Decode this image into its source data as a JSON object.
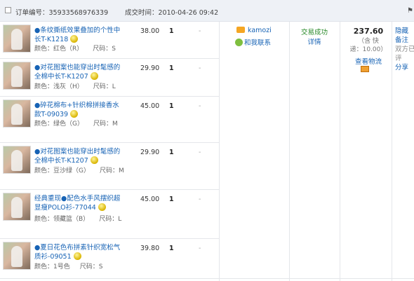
{
  "header": {
    "order_label": "订单编号：35933568976339",
    "time_label": "成交时间：2010-04-26 09:42",
    "flag_icon": "flag-icon"
  },
  "items": [
    {
      "title": "●条纹撕纸效果叠加的个性中长T-K1218",
      "attrs": "颜色：红色（R）",
      "size": "尺码：S",
      "price": "38.00",
      "qty": "1",
      "dash": "-"
    },
    {
      "title": "●对花图案也能穿出时髦感的全棉中长T-K1207",
      "attrs": "颜色：浅灰（H）",
      "size": "尺码：L",
      "price": "29.90",
      "qty": "1",
      "dash": "-"
    },
    {
      "title": "●碎花棉布+针织棉拼接香水款T-09039",
      "attrs": "颜色：绿色（G）",
      "size": "尺码：M",
      "price": "45.00",
      "qty": "1",
      "dash": "-"
    },
    {
      "title": "●对花图案也能穿出时髦感的全棉中长T-K1207",
      "attrs": "颜色：豆沙绿（G）",
      "size": "尺码：M",
      "price": "29.90",
      "qty": "1",
      "dash": "-"
    },
    {
      "title": "经典重现●配色水手风摆织超显瘦POLO衫-77044",
      "attrs": "颜色：领藏篮（B）",
      "size": "尺码：L",
      "price": "45.00",
      "qty": "1",
      "dash": "-"
    },
    {
      "title": "●夏日花色布拼素针织宽松气质衫-09051",
      "attrs": "颜色：1号色",
      "size": "尺码：S",
      "price": "39.80",
      "qty": "1",
      "dash": "-"
    }
  ],
  "buyer": {
    "name": "kamozi",
    "chat_label": "和我联系"
  },
  "status": {
    "state": "交易成功",
    "detail": "详情"
  },
  "payment": {
    "total": "237.60",
    "shipping_line1": "（含 快",
    "shipping_line2": "递：10.00）",
    "logistics": "查看物流"
  },
  "ops": {
    "hide": "隐藏",
    "note": "备注",
    "rate": "双方已评",
    "share": "分享"
  }
}
